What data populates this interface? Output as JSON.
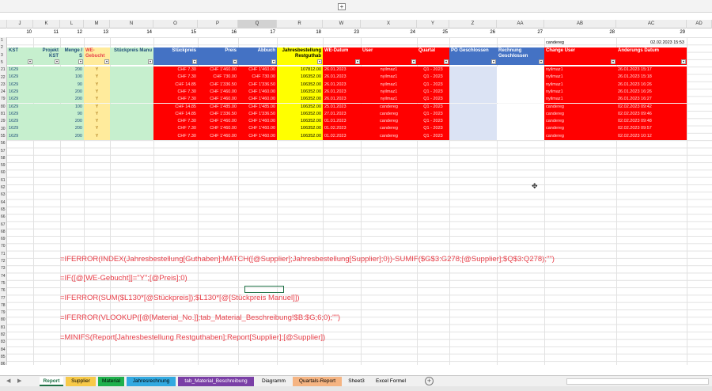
{
  "window": {
    "expand_label": "+"
  },
  "columns": [
    {
      "letter": "J",
      "num": "10"
    },
    {
      "letter": "K",
      "num": "11"
    },
    {
      "letter": "L",
      "num": "12"
    },
    {
      "letter": "M",
      "num": "13"
    },
    {
      "letter": "N",
      "num": "14"
    },
    {
      "letter": "O",
      "num": "15"
    },
    {
      "letter": "P",
      "num": "16"
    },
    {
      "letter": "Q",
      "num": "17"
    },
    {
      "letter": "R",
      "num": "18"
    },
    {
      "letter": "W",
      "num": "23"
    },
    {
      "letter": "X",
      "num": "24"
    },
    {
      "letter": "Y",
      "num": "25"
    },
    {
      "letter": "Z",
      "num": "26"
    },
    {
      "letter": "AA",
      "num": "27"
    },
    {
      "letter": "AB",
      "num": "28"
    },
    {
      "letter": "AC",
      "num": "29"
    },
    {
      "letter": "AD",
      "num": ""
    }
  ],
  "info": {
    "user": "candereg",
    "timestamp": "02.02.2023 15:53"
  },
  "headers": {
    "kst": "KST",
    "projekt": "Projekt KST",
    "menge": "Menge / S",
    "we_gebucht": "WE-Gebucht",
    "stueckpreis_manuell": "Stückpreis Manu",
    "stueckpreis": "Stückpreis",
    "preis": "Preis",
    "abbuchung": "Abbuch",
    "jahresbestellung": "Jahresbestellung Restguthab",
    "we_datum": "WE-Datum",
    "user": "User",
    "quartal": "Quartal",
    "po_geschlossen": "PO Geschlossen",
    "rechnung_geschlossen": "Rechnung Geschlossen",
    "change_user": "Change User",
    "aenderung_datum": "Änderungs Datum"
  },
  "row_numbers": [
    "1",
    "2",
    "3",
    "5",
    "21",
    "22",
    "23",
    "24",
    "79",
    "80",
    "81",
    "29",
    "30",
    "55",
    "56",
    "57",
    "58",
    "59",
    "60",
    "61",
    "62",
    "63",
    "64",
    "65",
    "66",
    "67",
    "68",
    "69",
    "70",
    "71",
    "72",
    "73",
    "74",
    "75",
    "76",
    "77",
    "78",
    "79",
    "80",
    "81",
    "82",
    "83",
    "84",
    "85",
    "86"
  ],
  "rows": [
    {
      "kst": "1629",
      "menge": "200",
      "we": "Y",
      "stueck": "CHF 7.30",
      "preis": "CHF 1'460.00",
      "abbuch": "CHF 1'460.00",
      "rest": "107812.00",
      "datum": "26.01.2023",
      "user": "nyilmaz1",
      "quartal": "Q1 - 2023",
      "cuser": "nyilmaz1",
      "cdatum": "26.01.2023 15:17"
    },
    {
      "kst": "1629",
      "menge": "100",
      "we": "Y",
      "stueck": "CHF 7.30",
      "preis": "CHF 730.00",
      "abbuch": "CHF 730.00",
      "rest": "106352.00",
      "datum": "26.01.2023",
      "user": "nyilmaz1",
      "quartal": "Q1 - 2023",
      "cuser": "nyilmaz1",
      "cdatum": "26.01.2023 15:18"
    },
    {
      "kst": "1629",
      "menge": "90",
      "we": "Y",
      "stueck": "CHF 14.85",
      "preis": "CHF 1'336.50",
      "abbuch": "CHF 1'336.50",
      "rest": "106352.00",
      "datum": "26.01.2023",
      "user": "nyilmaz1",
      "quartal": "Q1 - 2023",
      "cuser": "nyilmaz1",
      "cdatum": "26.01.2023 16:26"
    },
    {
      "kst": "1629",
      "menge": "200",
      "we": "Y",
      "stueck": "CHF 7.30",
      "preis": "CHF 1'460.00",
      "abbuch": "CHF 1'460.00",
      "rest": "106352.00",
      "datum": "26.01.2023",
      "user": "nyilmaz1",
      "quartal": "Q1 - 2023",
      "cuser": "nyilmaz1",
      "cdatum": "26.01.2023 16:26"
    },
    {
      "kst": "1629",
      "menge": "200",
      "we": "Y",
      "stueck": "CHF 7.30",
      "preis": "CHF 1'460.00",
      "abbuch": "CHF 1'460.00",
      "rest": "106352.00",
      "datum": "26.01.2023",
      "user": "nyilmaz1",
      "quartal": "Q1 - 2023",
      "cuser": "nyilmaz1",
      "cdatum": "26.01.2023 16:27"
    },
    {
      "kst": "1629",
      "menge": "100",
      "we": "Y",
      "stueck": "CHF 14.85",
      "preis": "CHF 1'485.00",
      "abbuch": "CHF 1'485.00",
      "rest": "106352.00",
      "datum": "25.01.2023",
      "user": "candereg",
      "quartal": "Q1 - 2023",
      "cuser": "candereg",
      "cdatum": "02.02.2023 09:42"
    },
    {
      "kst": "1629",
      "menge": "90",
      "we": "Y",
      "stueck": "CHF 14.85",
      "preis": "CHF 1'336.50",
      "abbuch": "CHF 1'336.50",
      "rest": "106352.00",
      "datum": "27.01.2023",
      "user": "candereg",
      "quartal": "Q1 - 2023",
      "cuser": "candereg",
      "cdatum": "02.02.2023 09:46"
    },
    {
      "kst": "1629",
      "menge": "200",
      "we": "Y",
      "stueck": "CHF 7.30",
      "preis": "CHF 1'460.00",
      "abbuch": "CHF 1'460.00",
      "rest": "106352.00",
      "datum": "01.01.2023",
      "user": "candereg",
      "quartal": "Q1 - 2023",
      "cuser": "candereg",
      "cdatum": "02.02.2023 09:48"
    },
    {
      "kst": "1629",
      "menge": "200",
      "we": "Y",
      "stueck": "CHF 7.30",
      "preis": "CHF 1'460.00",
      "abbuch": "CHF 1'460.00",
      "rest": "106352.00",
      "datum": "01.02.2023",
      "user": "candereg",
      "quartal": "Q1 - 2023",
      "cuser": "candereg",
      "cdatum": "02.02.2023 09:57"
    },
    {
      "kst": "1629",
      "menge": "200",
      "we": "Y",
      "stueck": "CHF 7.30",
      "preis": "CHF 1'460.00",
      "abbuch": "CHF 1'460.00",
      "rest": "106352.00",
      "datum": "01.02.2023",
      "user": "candereg",
      "quartal": "Q1 - 2023",
      "cuser": "candereg",
      "cdatum": "02.02.2023 10:12"
    }
  ],
  "formulas": [
    "=IFERROR(INDEX(Jahresbestellung[Guthaben];MATCH([@Supplier];Jahresbestellung[Supplier];0))-SUMIF($G$3:G278;[@Supplier];$Q$3:Q278);\"\")",
    "=IF([@[WE-Gebucht]]=\"Y\";[@Preis];0)",
    "=IFERROR(SUM($L130*[@Stückpreis]);$L130*[@[Stückpreis Manuel]])",
    "=IFERROR(VLOOKUP([@[Material_No.]];tab_Material_Beschreibung!$B:$G;6;0);\"\")",
    "=MINIFS(Report[Jahresbestellung Restguthaben];Report[Supplier];[@Supplier])"
  ],
  "tabs": [
    {
      "label": "Report",
      "color": "#ffffff"
    },
    {
      "label": "Supplier",
      "color": "#f7c948"
    },
    {
      "label": "Material",
      "color": "#1fb04c"
    },
    {
      "label": "Jahresrechnung",
      "color": "#32a9e0"
    },
    {
      "label": "tab_Material_Beschreibung",
      "color": "#7a3fa6"
    },
    {
      "label": "Diagramm",
      "color": "#f0f0f0"
    },
    {
      "label": "Quartals-Report",
      "color": "#f5b482"
    },
    {
      "label": "Sheet3",
      "color": "#f0f0f0"
    },
    {
      "label": "Excel Formel",
      "color": "#f0f0f0"
    }
  ],
  "nav": {
    "prev": "◀",
    "next": "▶",
    "add": "+"
  },
  "colors": {
    "green": "#c6efce",
    "blue": "#4472c4",
    "yellow": "#ffff00",
    "red": "#ff0000",
    "formula": "#e8404a",
    "light_yellow": "#ffeb9c"
  }
}
